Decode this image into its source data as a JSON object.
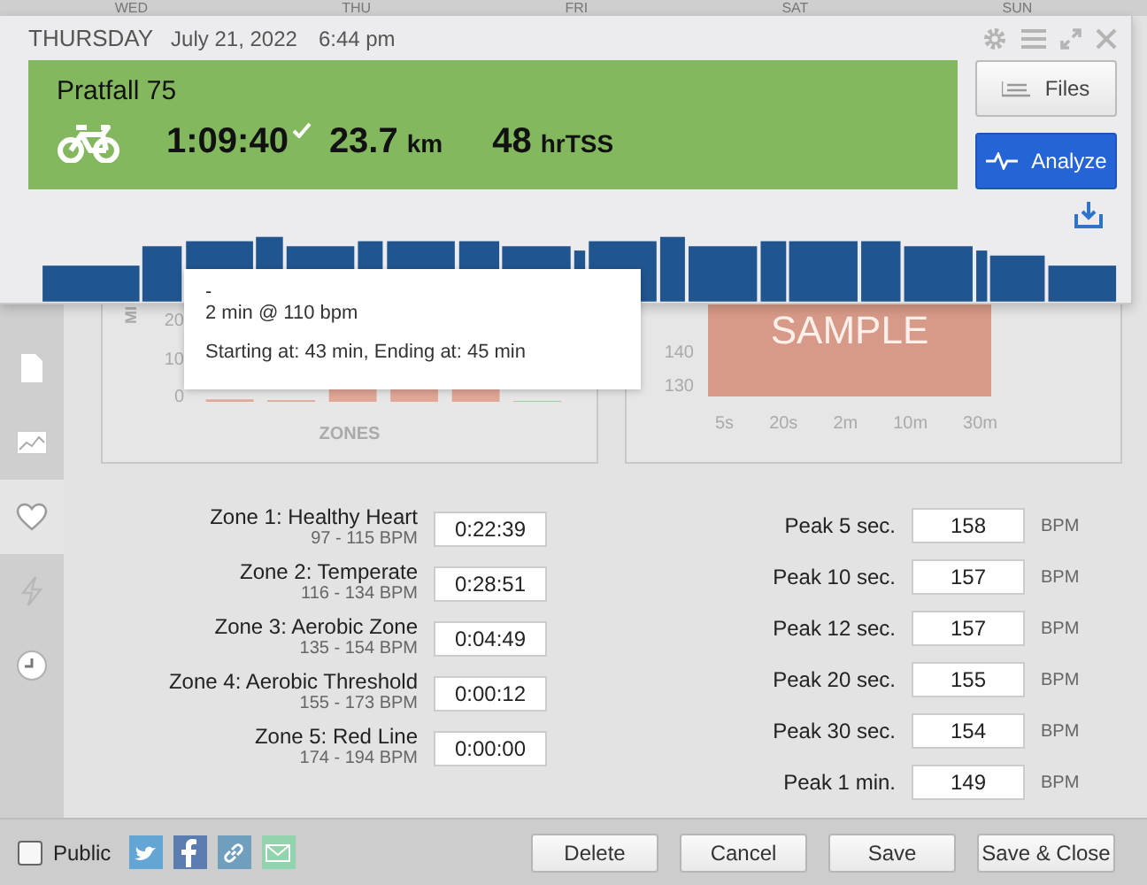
{
  "calendar_header": {
    "days": [
      "WED",
      "THU",
      "FRI",
      "SAT",
      "SUN"
    ]
  },
  "workout": {
    "day": "THURSDAY",
    "date": "July 21, 2022",
    "time": "6:44 pm",
    "title": "Pratfall 75",
    "duration": "1:09:40",
    "completed": true,
    "distance": "23.7",
    "distance_unit": "km",
    "tss": "48",
    "tss_unit": "hrTSS"
  },
  "actions": [
    {
      "label": "Files",
      "kind": "secondary"
    },
    {
      "label": "Analyze",
      "kind": "primary"
    }
  ],
  "tooltip": {
    "title": "-",
    "summary": "2 min @ 110 bpm",
    "range": "Starting at: 43 min, Ending at: 45 min"
  },
  "sidebar": {
    "items": [
      {
        "kind": "file",
        "selected": false
      },
      {
        "kind": "chart",
        "selected": false
      },
      {
        "kind": "heart",
        "selected": true
      },
      {
        "kind": "power",
        "selected": false
      },
      {
        "kind": "clock",
        "selected": false
      }
    ]
  },
  "zone_chart": {
    "axis_label": "MI",
    "y_ticks": [
      "20",
      "10",
      "0"
    ],
    "x_label": "ZONES"
  },
  "peak_chart": {
    "watermark": "SAMPLE",
    "y_ticks": [
      "140",
      "130"
    ],
    "x_ticks": [
      "5s",
      "20s",
      "2m",
      "10m",
      "30m"
    ]
  },
  "zones": [
    {
      "name": "Zone 1: Healthy Heart",
      "range": "97 - 115 BPM",
      "time": "0:22:39"
    },
    {
      "name": "Zone 2: Temperate",
      "range": "116 - 134 BPM",
      "time": "0:28:51"
    },
    {
      "name": "Zone 3: Aerobic Zone",
      "range": "135 - 154 BPM",
      "time": "0:04:49"
    },
    {
      "name": "Zone 4: Aerobic Threshold",
      "range": "155 - 173 BPM",
      "time": "0:00:12"
    },
    {
      "name": "Zone 5: Red Line",
      "range": "174 - 194 BPM",
      "time": "0:00:00"
    }
  ],
  "peaks": [
    {
      "label": "Peak 5 sec.",
      "value": "158",
      "unit": "BPM"
    },
    {
      "label": "Peak 10 sec.",
      "value": "157",
      "unit": "BPM"
    },
    {
      "label": "Peak 12 sec.",
      "value": "157",
      "unit": "BPM"
    },
    {
      "label": "Peak 20 sec.",
      "value": "155",
      "unit": "BPM"
    },
    {
      "label": "Peak 30 sec.",
      "value": "154",
      "unit": "BPM"
    },
    {
      "label": "Peak 1 min.",
      "value": "149",
      "unit": "BPM"
    }
  ],
  "footer": {
    "public_label": "Public",
    "public_checked": false,
    "share": [
      {
        "kind": "twitter"
      },
      {
        "kind": "facebook"
      },
      {
        "kind": "link"
      },
      {
        "kind": "email"
      }
    ],
    "buttons": [
      "Delete",
      "Cancel",
      "Save",
      "Save & Close"
    ]
  }
}
